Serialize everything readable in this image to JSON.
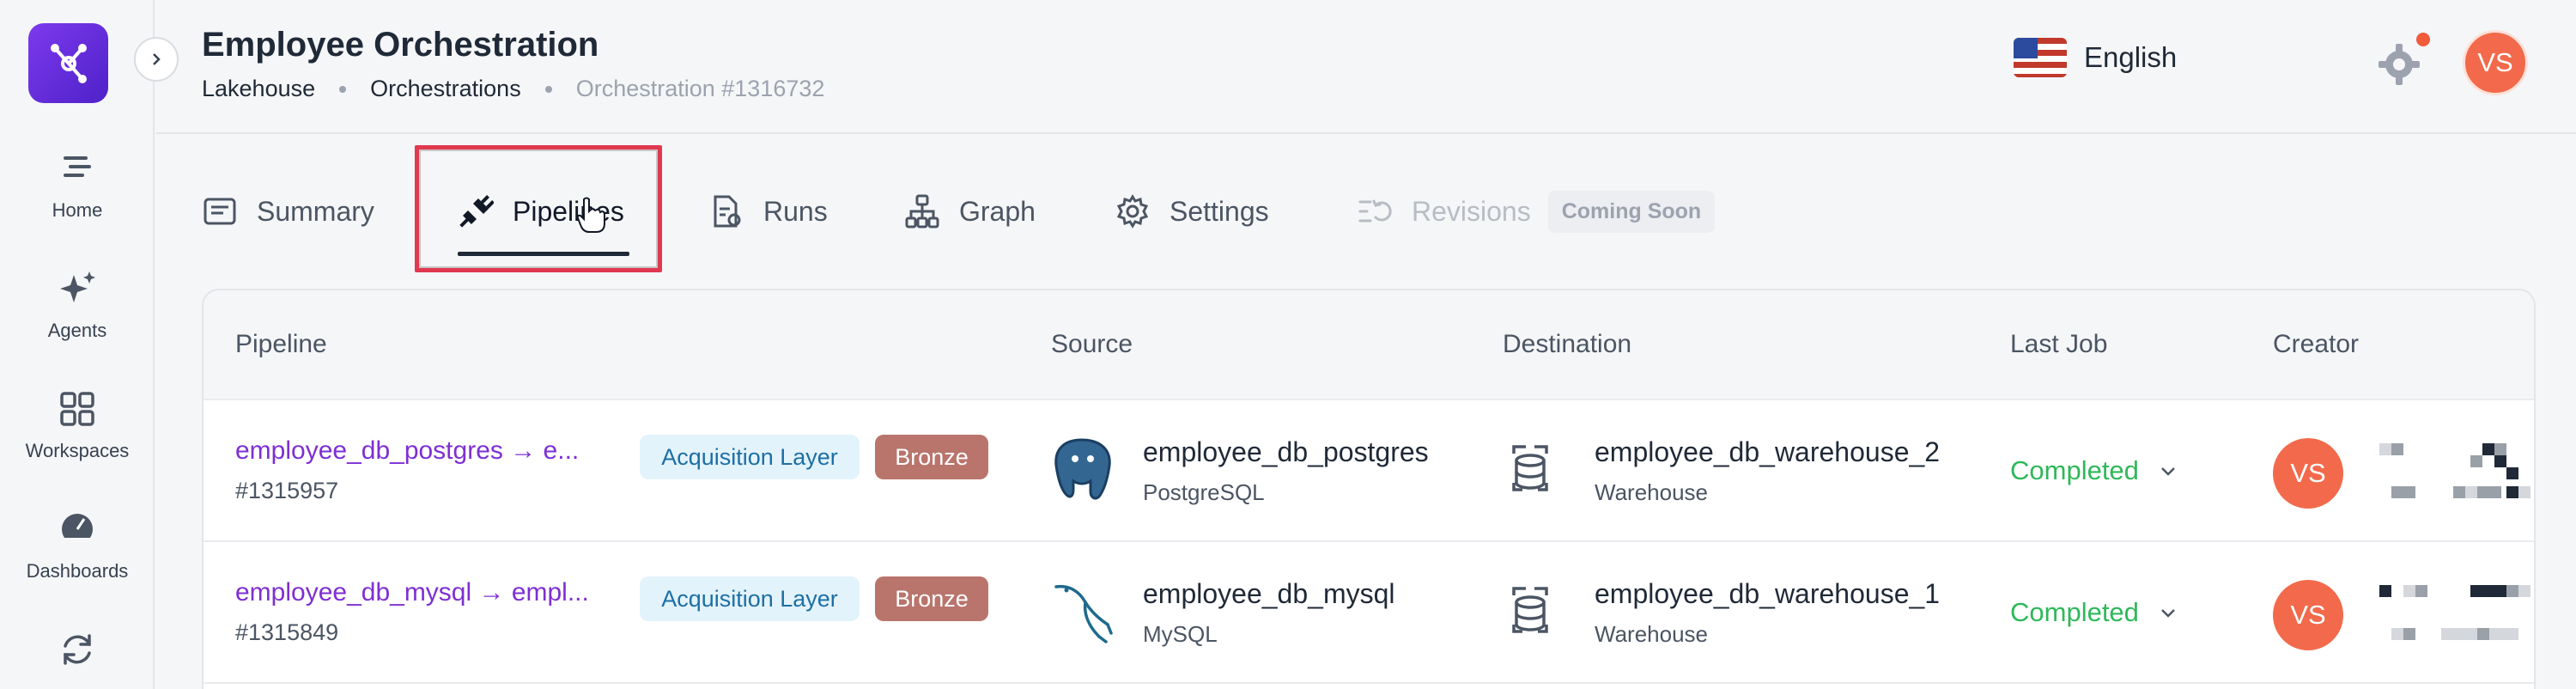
{
  "app": {
    "title": "Employee Orchestration",
    "breadcrumbs": [
      "Lakehouse",
      "Orchestrations",
      "Orchestration #1316732"
    ]
  },
  "sidebar": {
    "items": [
      {
        "label": "Home",
        "icon": "home-icon"
      },
      {
        "label": "Agents",
        "icon": "sparkles-icon"
      },
      {
        "label": "Workspaces",
        "icon": "grid-icon"
      },
      {
        "label": "Dashboards",
        "icon": "gauge-icon"
      },
      {
        "label": "",
        "icon": "sync-icon"
      }
    ]
  },
  "header": {
    "language": "English",
    "user_initials": "VS"
  },
  "tabs": [
    {
      "label": "Summary",
      "icon": "summary-icon"
    },
    {
      "label": "Pipelines",
      "icon": "plug-icon",
      "active": true
    },
    {
      "label": "Runs",
      "icon": "file-run-icon"
    },
    {
      "label": "Graph",
      "icon": "hierarchy-icon"
    },
    {
      "label": "Settings",
      "icon": "gear-icon"
    },
    {
      "label": "Revisions",
      "icon": "revisions-icon",
      "disabled": true,
      "badge": "Coming Soon"
    }
  ],
  "table": {
    "columns": [
      "Pipeline",
      "Source",
      "Destination",
      "Last Job",
      "Creator"
    ],
    "rows": [
      {
        "pipeline": "employee_db_postgres → e...",
        "id": "#1315957",
        "layer": "Acquisition Layer",
        "tier": "Bronze",
        "source_name": "employee_db_postgres",
        "source_type": "PostgreSQL",
        "dest_name": "employee_db_warehouse_2",
        "dest_type": "Warehouse",
        "status": "Completed",
        "creator": "VS"
      },
      {
        "pipeline": "employee_db_mysql → empl...",
        "id": "#1315849",
        "layer": "Acquisition Layer",
        "tier": "Bronze",
        "source_name": "employee_db_mysql",
        "source_type": "MySQL",
        "dest_name": "employee_db_warehouse_1",
        "dest_type": "Warehouse",
        "status": "Completed",
        "creator": "VS"
      }
    ]
  },
  "colors": {
    "accent": "#7e2fd3",
    "status_completed": "#2fb85a",
    "avatar": "#f26a4b",
    "bronze": "#b9746c",
    "highlight": "#e0384f"
  }
}
